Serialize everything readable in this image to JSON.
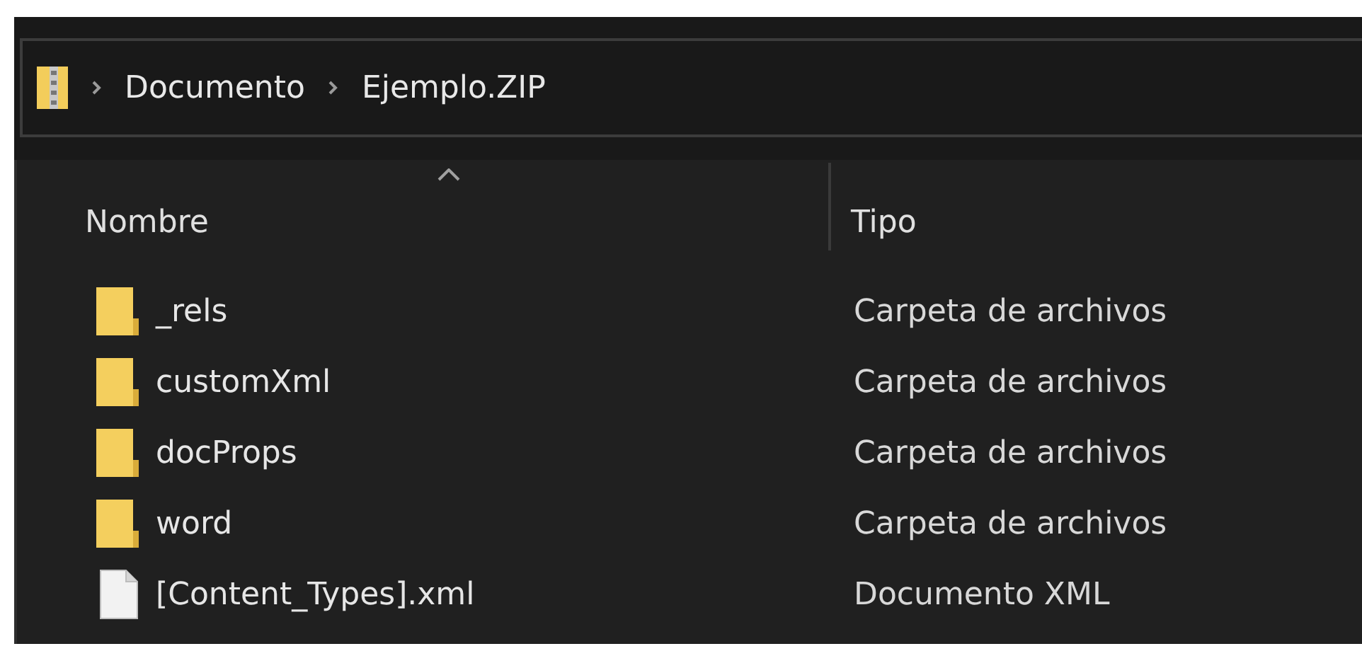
{
  "breadcrumb": [
    {
      "label": "Documento"
    },
    {
      "label": "Ejemplo.ZIP"
    }
  ],
  "columns": [
    {
      "label": "Nombre",
      "sorted": true
    },
    {
      "label": "Tipo",
      "sorted": false
    }
  ],
  "rows": [
    {
      "kind": "folder",
      "name": "_rels",
      "type": "Carpeta de archivos"
    },
    {
      "kind": "folder",
      "name": "customXml",
      "type": "Carpeta de archivos"
    },
    {
      "kind": "folder",
      "name": "docProps",
      "type": "Carpeta de archivos"
    },
    {
      "kind": "folder",
      "name": "word",
      "type": "Carpeta de archivos"
    },
    {
      "kind": "file",
      "name": "[Content_Types].xml",
      "type": "Documento XML"
    }
  ]
}
